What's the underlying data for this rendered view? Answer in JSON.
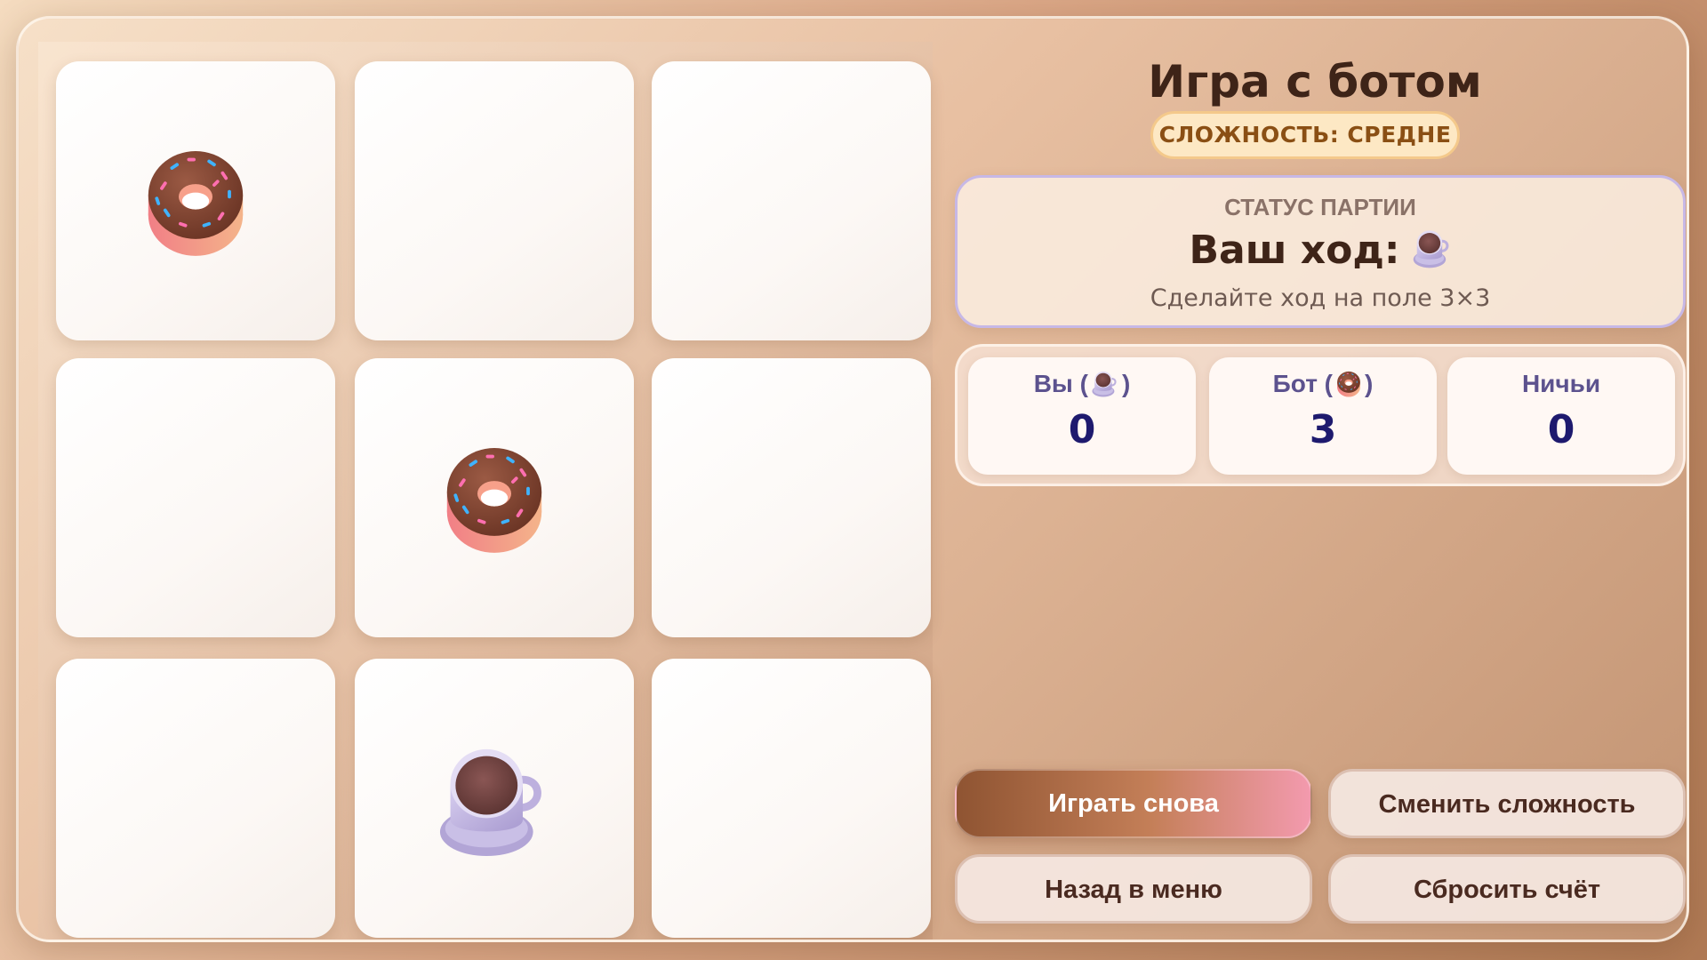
{
  "board": {
    "cells": [
      "donut",
      "",
      "",
      "",
      "donut",
      "",
      "",
      "cup",
      ""
    ]
  },
  "panel": {
    "title": "Игра с ботом",
    "difficulty_badge": "СЛОЖНОСТЬ: СРЕДНЕ",
    "status": {
      "label": "СТАТУС ПАРТИИ",
      "main": "Ваш ход:",
      "main_icon": "cup-icon",
      "hint": "Сделайте ход на поле 3×3"
    },
    "score": {
      "you": {
        "label_before": "Вы (",
        "label_after": ")",
        "icon": "cup-icon",
        "value": "0"
      },
      "bot": {
        "label_before": "Бот (",
        "label_after": ")",
        "icon": "donut-icon",
        "value": "3"
      },
      "draws": {
        "label": "Ничьи",
        "value": "0"
      }
    },
    "buttons": {
      "play_again": "Играть снова",
      "change_difficulty": "Сменить сложность",
      "back_to_menu": "Назад в меню",
      "reset_score": "Сбросить счёт"
    }
  },
  "colors": {
    "title": "#3e2418",
    "badge_bg": "#fde8c4",
    "badge_text": "#8a4f14",
    "score_value": "#1e1a6e",
    "score_label": "#5c528e",
    "status_border": "#c7b8e6",
    "donut_icing": "#7a4030",
    "donut_base": "#f08a8a",
    "cup_body": "#b5a8d8",
    "cup_coffee": "#7a4a48"
  }
}
